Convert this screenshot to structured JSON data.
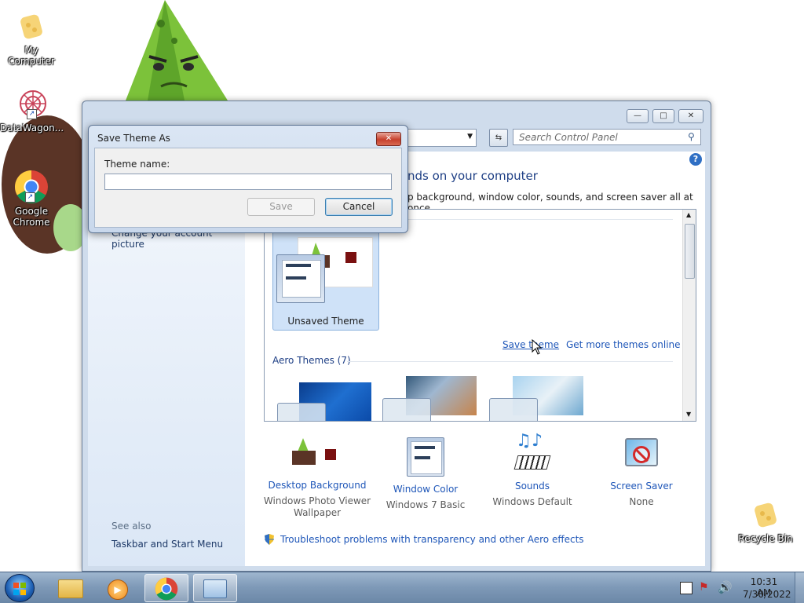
{
  "desktop": {
    "icons": [
      {
        "label": "My Computer"
      },
      {
        "label": "DataWagon..."
      },
      {
        "label": "Google Chrome"
      },
      {
        "label": "Recycle Bin"
      }
    ]
  },
  "window": {
    "search_placeholder": "Search Control Panel",
    "heading_partial": "nds on your computer",
    "subheading_partial": "p background, window color, sounds, and screen saver all at once.",
    "left_links": [
      "Change your account picture"
    ],
    "see_also": {
      "title": "See also",
      "links": [
        "Taskbar and Start Menu"
      ]
    },
    "my_themes": {
      "unsaved_label": "Unsaved Theme",
      "save_link": "Save theme",
      "online_link": "Get more themes online"
    },
    "aero_header": "Aero Themes (7)",
    "bottom_items": [
      {
        "title": "Desktop Background",
        "subtitle": "Windows Photo Viewer Wallpaper"
      },
      {
        "title": "Window Color",
        "subtitle": "Windows 7 Basic"
      },
      {
        "title": "Sounds",
        "subtitle": "Windows Default"
      },
      {
        "title": "Screen Saver",
        "subtitle": "None"
      }
    ],
    "troubleshoot_link": "Troubleshoot problems with transparency and other Aero effects"
  },
  "dialog": {
    "title": "Save Theme As",
    "field_label": "Theme name:",
    "field_value": "",
    "save_label": "Save",
    "cancel_label": "Cancel"
  },
  "taskbar": {
    "time": "10:31 AM",
    "date": "7/30/2022"
  }
}
